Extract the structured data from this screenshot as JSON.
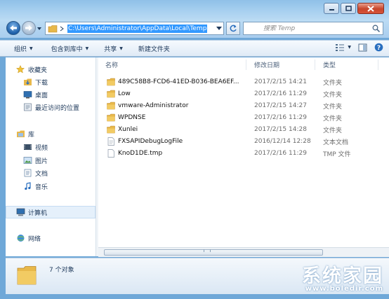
{
  "address": {
    "path": "C:\\Users\\Administrator\\AppData\\Local\\Temp"
  },
  "search": {
    "placeholder": "搜索 Temp"
  },
  "toolbar": {
    "organize": "组织",
    "include_in_library": "包含到库中",
    "share": "共享",
    "new_folder": "新建文件夹"
  },
  "nav": {
    "favorites": "收藏夹",
    "downloads": "下载",
    "desktop": "桌面",
    "recent": "最近访问的位置",
    "libraries": "库",
    "videos": "视频",
    "pictures": "图片",
    "documents": "文档",
    "music": "音乐",
    "computer": "计算机",
    "network": "网络"
  },
  "columns": {
    "name": "名称",
    "modified": "修改日期",
    "type": "类型"
  },
  "files": [
    {
      "name": "489C58B8-FCD6-41ED-B036-BEA6EF...",
      "date": "2017/2/15 14:21",
      "type": "文件夹",
      "kind": "folder"
    },
    {
      "name": "Low",
      "date": "2017/2/16 11:29",
      "type": "文件夹",
      "kind": "folder"
    },
    {
      "name": "vmware-Administrator",
      "date": "2017/2/15 14:27",
      "type": "文件夹",
      "kind": "folder"
    },
    {
      "name": "WPDNSE",
      "date": "2017/2/16 11:29",
      "type": "文件夹",
      "kind": "folder"
    },
    {
      "name": "Xunlei",
      "date": "2017/2/15 14:28",
      "type": "文件夹",
      "kind": "folder"
    },
    {
      "name": "FXSAPIDebugLogFile",
      "date": "2016/12/14 12:28",
      "type": "文本文档",
      "kind": "text"
    },
    {
      "name": "KnoD1DE.tmp",
      "date": "2017/2/16 11:29",
      "type": "TMP 文件",
      "kind": "file"
    }
  ],
  "status": {
    "count": "7 个对象"
  },
  "watermark": {
    "brand": "系统家园",
    "url": "www.boledir.com"
  },
  "colors": {
    "folder": "#e8b84a",
    "selection": "#3399ff",
    "frame": "#a9cdee"
  }
}
